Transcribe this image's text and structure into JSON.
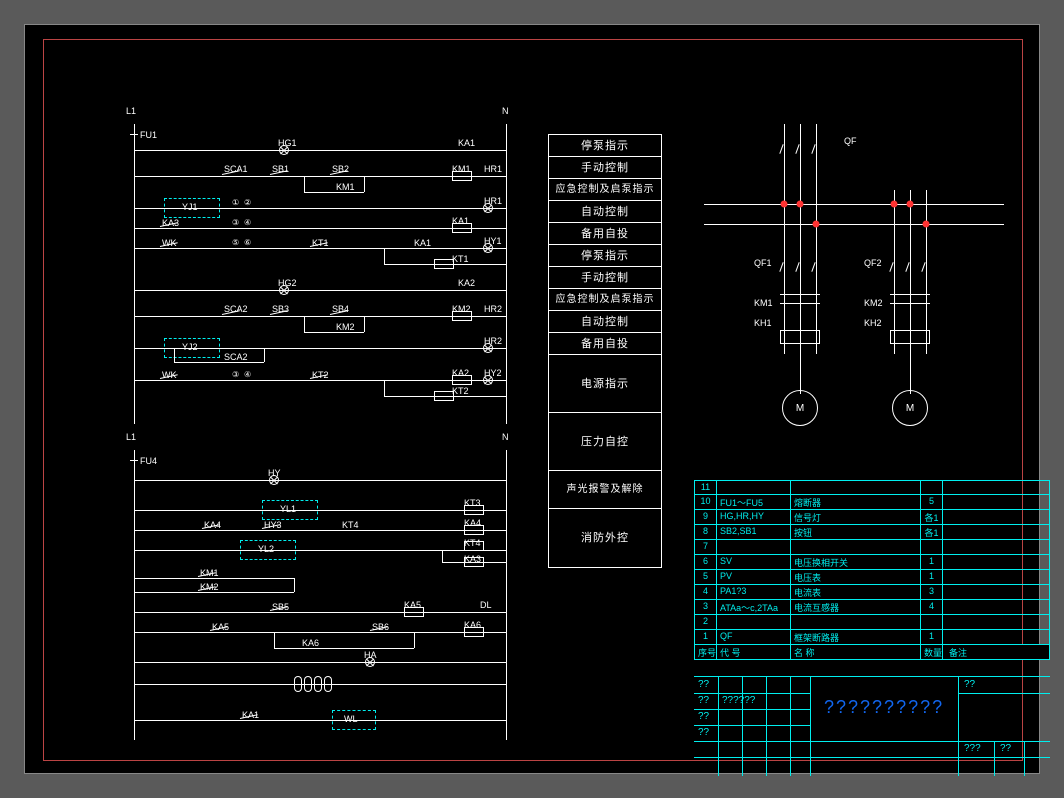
{
  "diagram": {
    "top_left_terminal": "L1",
    "fuse1": "FU1",
    "top_right_terminal": "N",
    "mid_left_terminal": "L1",
    "fuse4": "FU4",
    "mid_right_terminal": "N",
    "components": {
      "HG1": "HG1",
      "HG2": "HG2",
      "SCA1": "SCA1",
      "SCA2": "SCA2",
      "SB1": "SB1",
      "SB2": "SB2",
      "SB3": "SB3",
      "SB4": "SB4",
      "SB5": "SB5",
      "SB6": "SB6",
      "KM1": "KM1",
      "KM2": "KM2",
      "HR1": "HR1",
      "HR2": "HR2",
      "YJ1": "YJ1",
      "YJ2": "YJ2",
      "KA1": "KA1",
      "KA2": "KA2",
      "KA3": "KA3",
      "KA4": "KA4",
      "KA5": "KA5",
      "KA6": "KA6",
      "WK": "WK",
      "KT1": "KT1",
      "KT2": "KT2",
      "KT3": "KT3",
      "KT4": "KT4",
      "HY1": "HY1",
      "HY2": "HY2",
      "HY3": "HY3",
      "HY": "HY",
      "HA": "HA",
      "YL1": "YL1",
      "YL2": "YL2",
      "DL": "DL",
      "WL": "WL",
      "pins": {
        "p1": "①",
        "p2": "②",
        "p3": "③",
        "p4": "④",
        "p5": "⑤",
        "p6": "⑥"
      }
    }
  },
  "power": {
    "QF": "QF",
    "QF1": "QF1",
    "QF2": "QF2",
    "KM1": "KM1",
    "KM2": "KM2",
    "KH1": "KH1",
    "KH2": "KH2",
    "M": "M"
  },
  "functions": [
    "停泵指示",
    "手动控制",
    "应急控制及启泵指示",
    "自动控制",
    "备用自投",
    "停泵指示",
    "手动控制",
    "应急控制及启泵指示",
    "自动控制",
    "备用自投",
    "电源指示",
    "压力自控",
    "声光报警及解除",
    "消防外控"
  ],
  "partlist_header": {
    "idx": "序号",
    "code": "代 号",
    "name": "名 称",
    "spec": "",
    "qty": "数量",
    "note": "备注"
  },
  "partlist": [
    {
      "idx": "11",
      "code": "",
      "name": "",
      "spec": "",
      "qty": "",
      "note": ""
    },
    {
      "idx": "10",
      "code": "FU1～FU5",
      "name": "熔断器",
      "spec": "",
      "qty": "5",
      "note": ""
    },
    {
      "idx": "9",
      "code": "HG,HR,HY",
      "name": "信号灯",
      "spec": "",
      "qty": "各1",
      "note": ""
    },
    {
      "idx": "8",
      "code": "SB2,SB1",
      "name": "按钮",
      "spec": "",
      "qty": "各1",
      "note": ""
    },
    {
      "idx": "7",
      "code": "",
      "name": "",
      "spec": "",
      "qty": "",
      "note": ""
    },
    {
      "idx": "6",
      "code": "SV",
      "name": "电压换相开关",
      "spec": "",
      "qty": "1",
      "note": ""
    },
    {
      "idx": "5",
      "code": "PV",
      "name": "电压表",
      "spec": "",
      "qty": "1",
      "note": ""
    },
    {
      "idx": "4",
      "code": "PA1?3",
      "name": "电流表",
      "spec": "",
      "qty": "3",
      "note": ""
    },
    {
      "idx": "3",
      "code": "ATAa～c,2TAa",
      "name": "电流互感器",
      "spec": "",
      "qty": "4",
      "note": ""
    },
    {
      "idx": "2",
      "code": "",
      "name": "",
      "spec": "",
      "qty": "",
      "note": ""
    },
    {
      "idx": "1",
      "code": "QF",
      "name": "框架断路器",
      "spec": "",
      "qty": "1",
      "note": ""
    }
  ],
  "titleblock": {
    "labels": {
      "tl1": "??",
      "tl2": "??",
      "tl3": "??",
      "tl4": "??",
      "r1": "??",
      "r2": "??????",
      "r3": "???",
      "r4": "??"
    },
    "main": "??????????"
  }
}
